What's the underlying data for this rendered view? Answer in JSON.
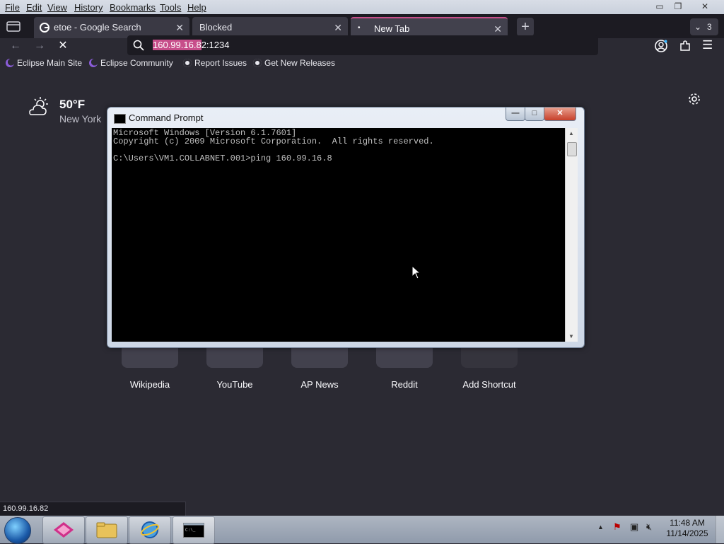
{
  "menubar": {
    "items": [
      "File",
      "Edit",
      "View",
      "History",
      "Bookmarks",
      "Tools",
      "Help"
    ]
  },
  "tabs": [
    {
      "label": "etoe - Google Search"
    },
    {
      "label": "Blocked"
    },
    {
      "label": "New Tab"
    }
  ],
  "tab_overflow_count": "3",
  "urlbar": {
    "highlighted": "160.99.16.8",
    "rest": "2:1234"
  },
  "bookmarks": [
    {
      "label": "Eclipse Main Site",
      "icon": "eclipse-icon"
    },
    {
      "label": "Eclipse Community",
      "icon": "eclipse-icon"
    },
    {
      "label": "Report Issues",
      "icon": "github-icon"
    },
    {
      "label": "Get New Releases",
      "icon": "github-icon"
    }
  ],
  "weather": {
    "temp": "50°F",
    "city": "New York",
    "icon": "partly-cloudy-icon"
  },
  "shortcuts": [
    {
      "label": "Wikipedia"
    },
    {
      "label": "YouTube"
    },
    {
      "label": "AP News"
    },
    {
      "label": "Reddit"
    },
    {
      "label": "Add Shortcut"
    }
  ],
  "cmd": {
    "title": "Command Prompt",
    "lines": [
      "Microsoft Windows [Version 6.1.7601]",
      "Copyright (c) 2009 Microsoft Corporation.  All rights reserved.",
      "",
      "C:\\Users\\VM1.COLLABNET.001>ping 160.99.16.8"
    ]
  },
  "status_url": "160.99.16.82",
  "clock": {
    "time": "11:48 AM",
    "date": "11/14/2025"
  },
  "colors": {
    "accent": "#c74e8a",
    "page_bg": "#2b2a33",
    "console_bg": "#000000"
  }
}
